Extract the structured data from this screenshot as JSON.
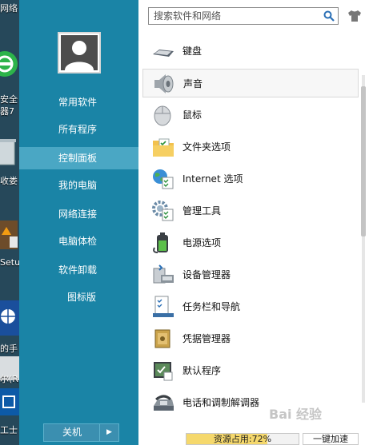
{
  "desktop": {
    "labels": [
      "网络",
      "安全",
      "器7",
      "收娄",
      "Setu",
      "的手",
      "尔(R",
      "工士"
    ]
  },
  "left_panel": {
    "nav_items": [
      {
        "label": "常用软件"
      },
      {
        "label": "所有程序"
      },
      {
        "label": "控制面板",
        "active": true
      },
      {
        "label": "我的电脑"
      },
      {
        "label": "网络连接"
      },
      {
        "label": "电脑体检"
      },
      {
        "label": "软件卸载"
      },
      {
        "label": "图标版"
      }
    ],
    "shutdown_label": "关机",
    "shutdown_arrow": "▶"
  },
  "right_panel": {
    "search_placeholder": "搜索软件和网络",
    "items": [
      {
        "label": "键盘",
        "icon": "keyboard-icon"
      },
      {
        "label": "声音",
        "icon": "speaker-icon",
        "hover": true
      },
      {
        "label": "鼠标",
        "icon": "mouse-icon"
      },
      {
        "label": "文件夹选项",
        "icon": "folder-options-icon"
      },
      {
        "label": "Internet 选项",
        "icon": "internet-options-icon"
      },
      {
        "label": "管理工具",
        "icon": "admin-tools-icon"
      },
      {
        "label": "电源选项",
        "icon": "power-options-icon"
      },
      {
        "label": "设备管理器",
        "icon": "device-manager-icon"
      },
      {
        "label": "任务栏和导航",
        "icon": "taskbar-icon"
      },
      {
        "label": "凭据管理器",
        "icon": "credential-manager-icon"
      },
      {
        "label": "默认程序",
        "icon": "default-programs-icon"
      },
      {
        "label": "电话和调制解调器",
        "icon": "phone-modem-icon"
      }
    ],
    "resource_text": "资源占用:72%",
    "resource_level": 0.72,
    "speedup_label": "一键加速"
  },
  "watermark": "Bai 经验",
  "colors": {
    "left_panel": "#1a84a6",
    "nav_active": "#4aa7c4",
    "resource_fill": "#f5d86c"
  }
}
